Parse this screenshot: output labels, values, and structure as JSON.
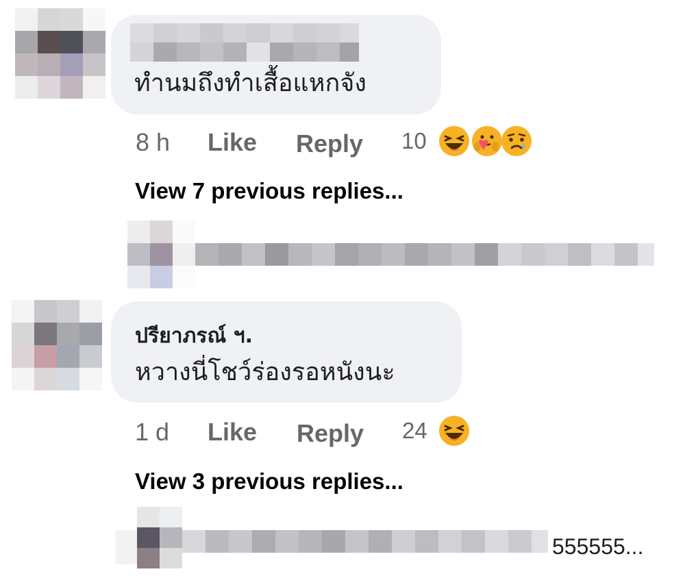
{
  "comments": [
    {
      "text": "ทำนมถึงทำเสื้อแหกจัง",
      "time": "8 h",
      "like_label": "Like",
      "reply_label": "Reply",
      "reaction_count": "10",
      "reactions": [
        "haha-icon",
        "care-icon",
        "sad-icon"
      ],
      "view_replies": "View 7 previous replies..."
    },
    {
      "author": "ปรียาภรณ์ ฯ.",
      "text": "หวางนี่โชว์ร่องรอหนังนะ",
      "time": "1 d",
      "like_label": "Like",
      "reply_label": "Reply",
      "reaction_count": "24",
      "reactions": [
        "haha-icon"
      ],
      "view_replies": "View 3 previous replies..."
    }
  ],
  "reply_preview_2": {
    "text": "555555..."
  },
  "colors": {
    "bubble": "#f0f1f5",
    "meta_text": "#65676b",
    "primary_text": "#050505",
    "reaction_yellow": "#f7b125"
  }
}
